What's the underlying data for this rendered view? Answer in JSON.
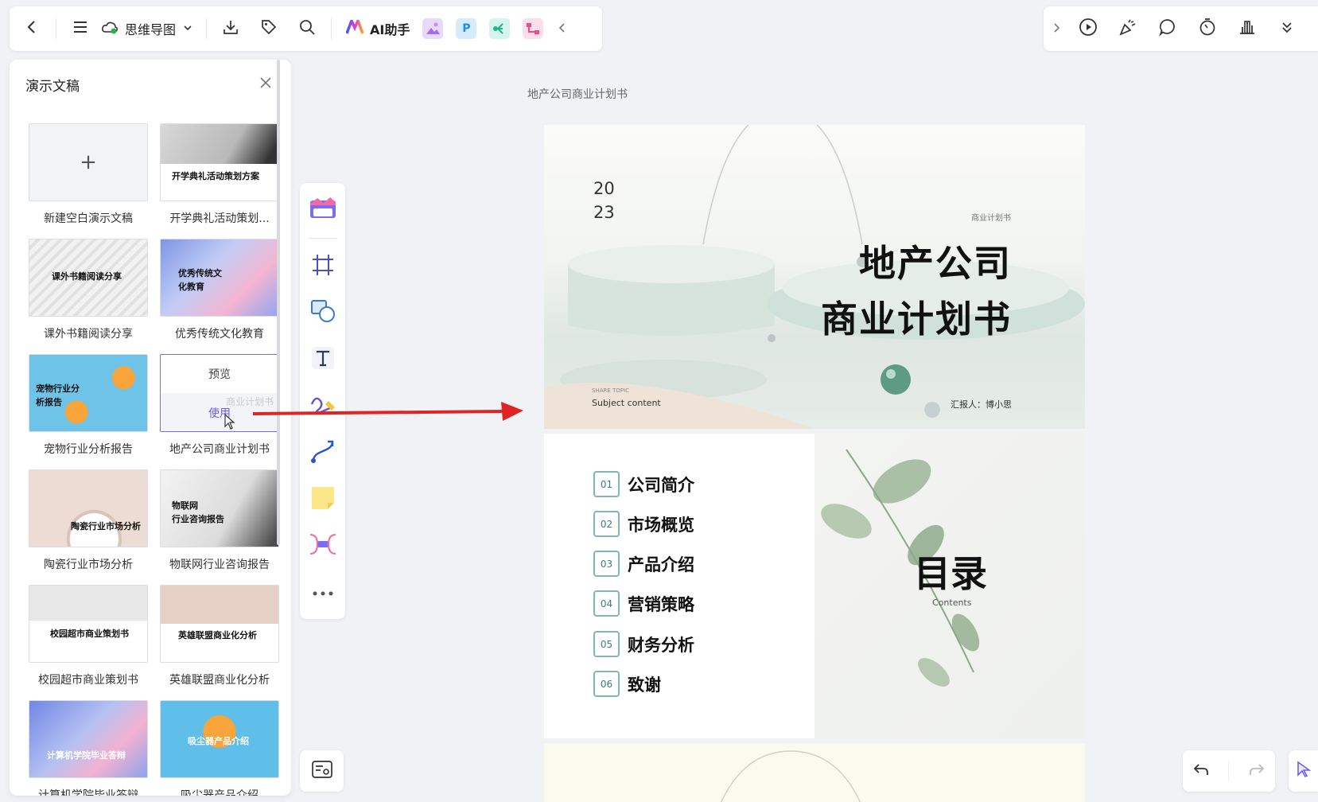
{
  "toolbar": {
    "doc_type": "思维导图",
    "ai_label": "AI助手",
    "app_p_label": "P"
  },
  "panel": {
    "title": "演示文稿",
    "new_blank_label": "新建空白演示文稿",
    "hover_preview": "预览",
    "hover_use": "使用",
    "templates": [
      {
        "label": "开学典礼活动策划...",
        "thumb_text": "开学典礼活动策划方案",
        "bg": "#ffffff"
      },
      {
        "label": "课外书籍阅读分享",
        "thumb_text": "课外书籍阅读分享",
        "bg": "#e9e9e9"
      },
      {
        "label": "优秀传统文化教育",
        "thumb_text": "优秀传统文\n化教育",
        "bg": "#b9c4ef"
      },
      {
        "label": "宠物行业分析报告",
        "thumb_text": "宠物行业分\n析报告",
        "bg": "#7cc6e8"
      },
      {
        "label": "地产公司商业计划书",
        "thumb_text": "商业计划书",
        "bg": "#ffffff"
      },
      {
        "label": "陶瓷行业市场分析",
        "thumb_text": "陶瓷行业市场分析",
        "bg": "#e8d6cc"
      },
      {
        "label": "物联网行业咨询报告",
        "thumb_text": "物联网\n行业咨询报告",
        "bg": "#e4e4e4"
      },
      {
        "label": "校园超市商业策划书",
        "thumb_text": "校园超市商业策划书",
        "bg": "#efefef"
      },
      {
        "label": "英雄联盟商业化分析",
        "thumb_text": "英雄联盟商业化分析",
        "bg": "#ead8cf"
      },
      {
        "label": "计算机学院毕业答辩",
        "thumb_text": "计算机学院毕业答辩",
        "bg": "#9fb0ec"
      },
      {
        "label": "吸尘器产品介绍",
        "thumb_text": "吸尘器产品介绍",
        "bg": "#6cc5ea"
      }
    ]
  },
  "canvas": {
    "doc_title": "地产公司商业计划书",
    "slide1": {
      "year_top": "20",
      "year_bottom": "23",
      "tag": "商业计划书",
      "title_line1": "地产公司",
      "title_line2": "商业计划书",
      "share_topic": "SHARE TOPIC",
      "subject": "Subject content",
      "reporter": "汇报人：博小思"
    },
    "slide2": {
      "heading": "目录",
      "heading_en": "Contents",
      "items": [
        {
          "num": "01",
          "text": "公司简介"
        },
        {
          "num": "02",
          "text": "市场概览"
        },
        {
          "num": "03",
          "text": "产品介绍"
        },
        {
          "num": "04",
          "text": "营销策略"
        },
        {
          "num": "05",
          "text": "财务分析"
        },
        {
          "num": "06",
          "text": "致谢"
        }
      ]
    }
  },
  "colors": {
    "accent": "#6b5cf5",
    "arrow": "#e02424",
    "toc_border": "#7fb7b7"
  }
}
